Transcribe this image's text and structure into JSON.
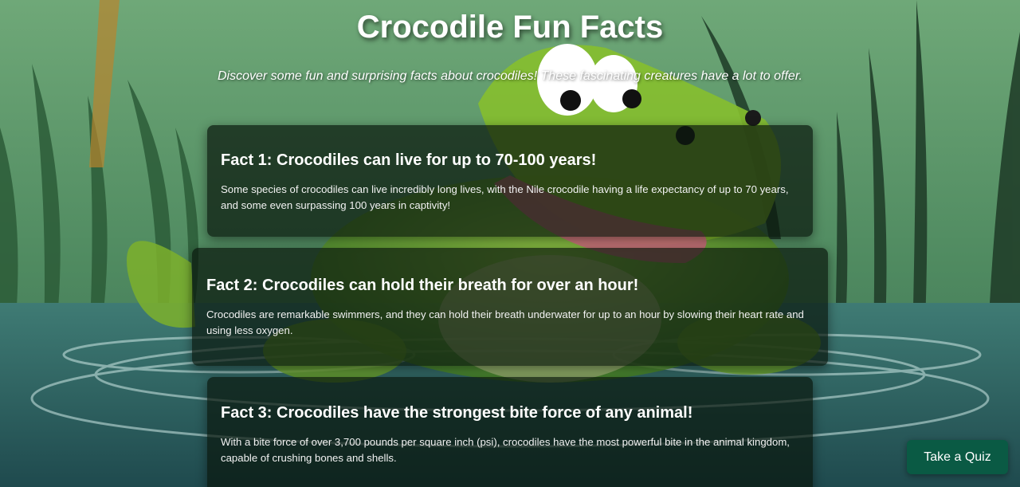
{
  "page": {
    "title": "Crocodile Fun Facts",
    "subtitle": "Discover some fun and surprising facts about crocodiles! These fascinating creatures have a lot to offer."
  },
  "facts": [
    {
      "title": "Fact 1: Crocodiles can live for up to 70-100 years!",
      "text": "Some species of crocodiles can live incredibly long lives, with the Nile crocodile having a life expectancy of up to 70 years, and some even surpassing 100 years in captivity!"
    },
    {
      "title": "Fact 2: Crocodiles can hold their breath for over an hour!",
      "text": "Crocodiles are remarkable swimmers, and they can hold their breath underwater for up to an hour by slowing their heart rate and using less oxygen."
    },
    {
      "title": "Fact 3: Crocodiles have the strongest bite force of any animal!",
      "text": "With a bite force of over 3,700 pounds per square inch (psi), crocodiles have the most powerful bite in the animal kingdom, capable of crushing bones and shells."
    }
  ],
  "quiz_button": {
    "label": "Take a Quiz"
  },
  "colors": {
    "background_green": "#5f9b6a",
    "water_teal": "#2f6466",
    "card_overlay": "#08160c",
    "button_green": "#0a5a44",
    "text": "#ffffff"
  }
}
